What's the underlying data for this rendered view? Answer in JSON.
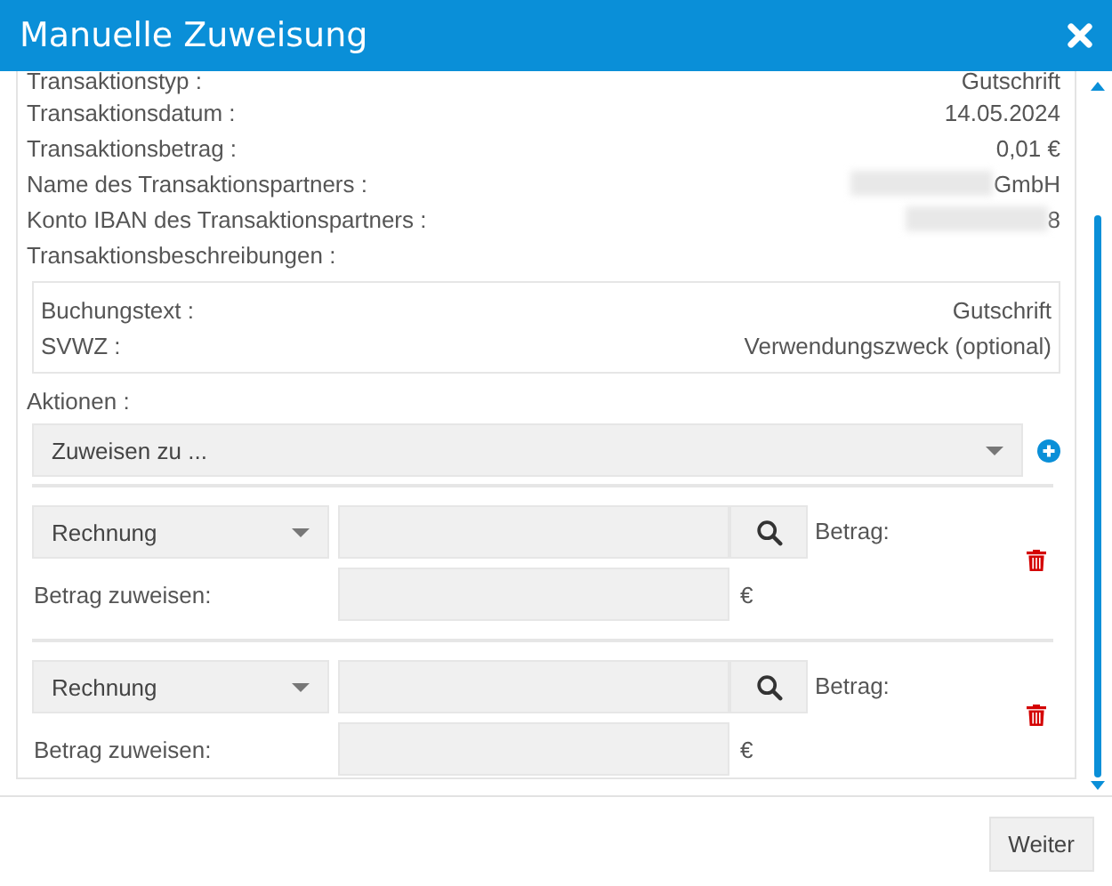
{
  "window": {
    "title": "Manuelle Zuweisung"
  },
  "details": [
    {
      "label": "Transaktionstyp :",
      "value": "Gutschrift",
      "blurred": false
    },
    {
      "label": "Transaktionsdatum :",
      "value": "14.05.2024",
      "blurred": false
    },
    {
      "label": "Transaktionsbetrag :",
      "value": "0,01 €",
      "blurred": false
    },
    {
      "label": "Name des Transaktionspartners :",
      "value": "GmbH",
      "blurred": true
    },
    {
      "label": "Konto IBAN des Transaktionspartners :",
      "value": "8",
      "blurred": true
    },
    {
      "label": "Transaktionsbeschreibungen :"
    }
  ],
  "descriptions": [
    {
      "label": "Buchungstext :",
      "value": "Gutschrift"
    },
    {
      "label": "SVWZ :",
      "value": "Verwendungszweck (optional)"
    }
  ],
  "actions": {
    "label": "Aktionen :",
    "select": "Zuweisen zu ..."
  },
  "assignments": [
    {
      "type": "Rechnung",
      "amount_label": "Betrag:",
      "assign_label": "Betrag zuweisen:",
      "currency": "€"
    },
    {
      "type": "Rechnung",
      "amount_label": "Betrag:",
      "assign_label": "Betrag zuweisen:",
      "currency": "€"
    }
  ],
  "footer": {
    "button": "Weiter"
  }
}
